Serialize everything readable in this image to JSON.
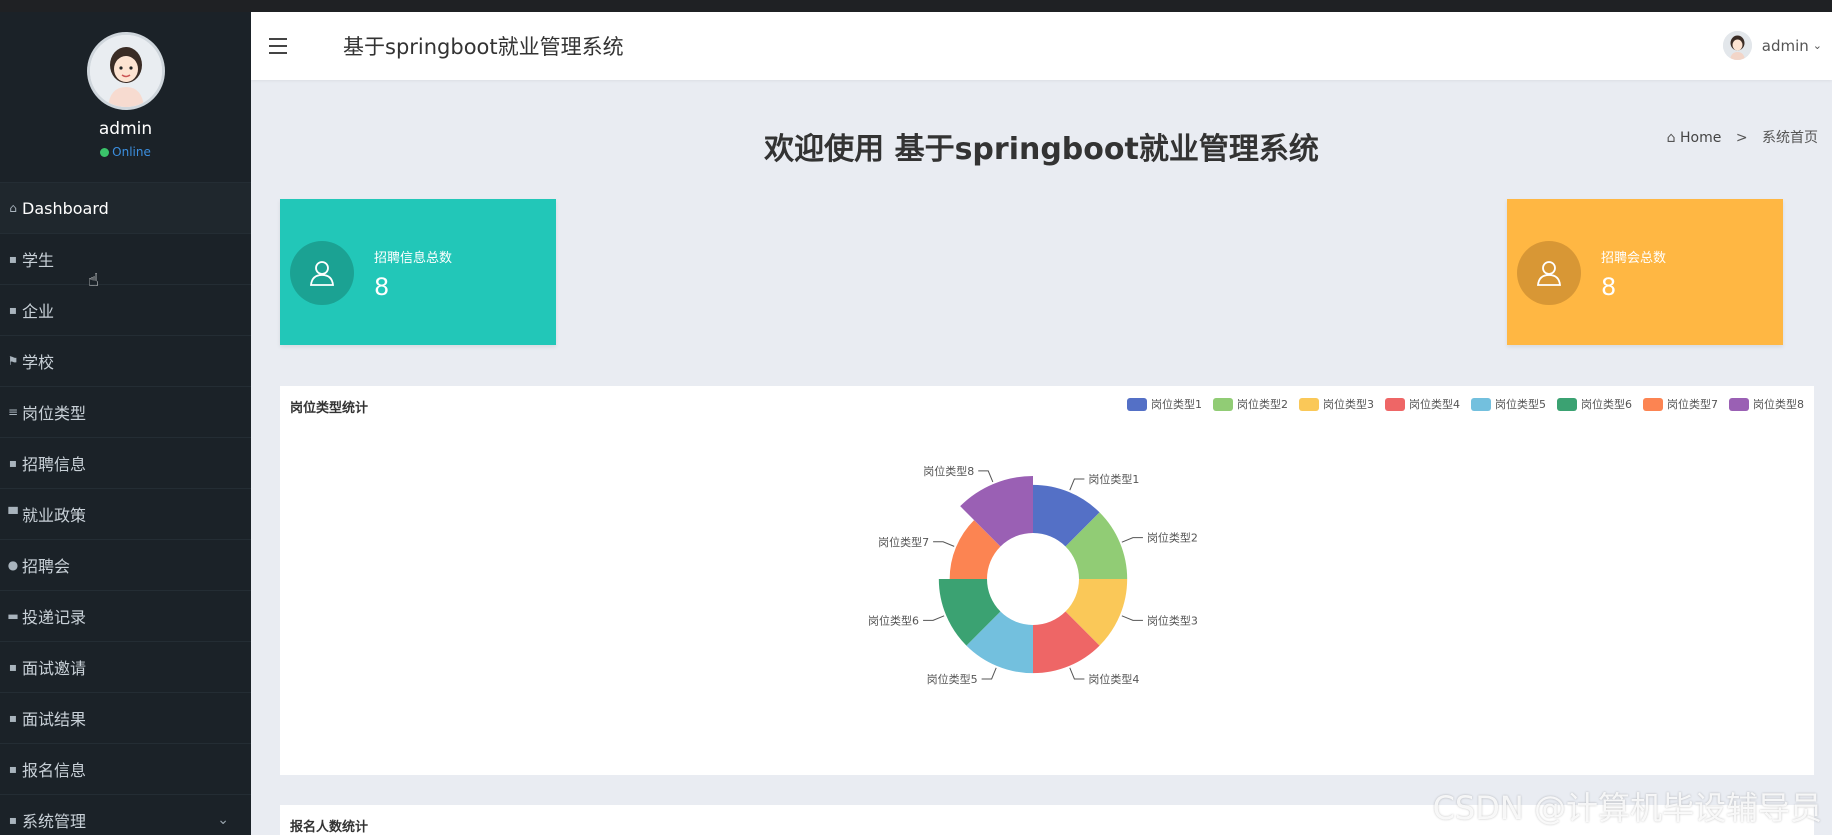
{
  "sidebar": {
    "profile": {
      "name": "admin",
      "status": "Online"
    },
    "items": [
      {
        "label": "Dashboard",
        "icon": "home-icon"
      },
      {
        "label": "学生",
        "icon": "grid-icon"
      },
      {
        "label": "企业",
        "icon": "grid-icon"
      },
      {
        "label": "学校",
        "icon": "flag-icon"
      },
      {
        "label": "岗位类型",
        "icon": "list-icon"
      },
      {
        "label": "招聘信息",
        "icon": "grid-icon"
      },
      {
        "label": "就业政策",
        "icon": "monitor-icon"
      },
      {
        "label": "招聘会",
        "icon": "pin-icon"
      },
      {
        "label": "投递记录",
        "icon": "ticket-icon"
      },
      {
        "label": "面试邀请",
        "icon": "grid-icon"
      },
      {
        "label": "面试结果",
        "icon": "grid-icon"
      },
      {
        "label": "报名信息",
        "icon": "grid-icon"
      },
      {
        "label": "系统管理",
        "icon": "grid-icon"
      }
    ]
  },
  "header": {
    "title": "基于springboot就业管理系统",
    "user": "admin"
  },
  "page": {
    "welcome": "欢迎使用 基于springboot就业管理系统",
    "breadcrumb": {
      "home": "Home",
      "separator": ">",
      "current": "系统首页"
    }
  },
  "stats": [
    {
      "label": "招聘信息总数",
      "value": "8",
      "color": "#22c7b8"
    },
    {
      "label": "招聘会总数",
      "value": "8",
      "color": "#ffb743"
    }
  ],
  "pie_panel": {
    "title": "岗位类型统计"
  },
  "second_panel": {
    "title": "报名人数统计"
  },
  "watermark": "CSDN @计算机毕设辅导员",
  "chart_data": {
    "type": "pie",
    "title": "岗位类型统计",
    "categories": [
      "岗位类型1",
      "岗位类型2",
      "岗位类型3",
      "岗位类型4",
      "岗位类型5",
      "岗位类型6",
      "岗位类型7",
      "岗位类型8"
    ],
    "values": [
      1,
      1,
      1,
      1,
      1,
      1,
      0.6,
      1.4
    ],
    "colors": [
      "#5470c6",
      "#91cc75",
      "#fac858",
      "#ee6666",
      "#73c0de",
      "#3ba272",
      "#fc8452",
      "#9a60b4"
    ],
    "legend_position": "top-right",
    "donut": true,
    "rose": true
  }
}
